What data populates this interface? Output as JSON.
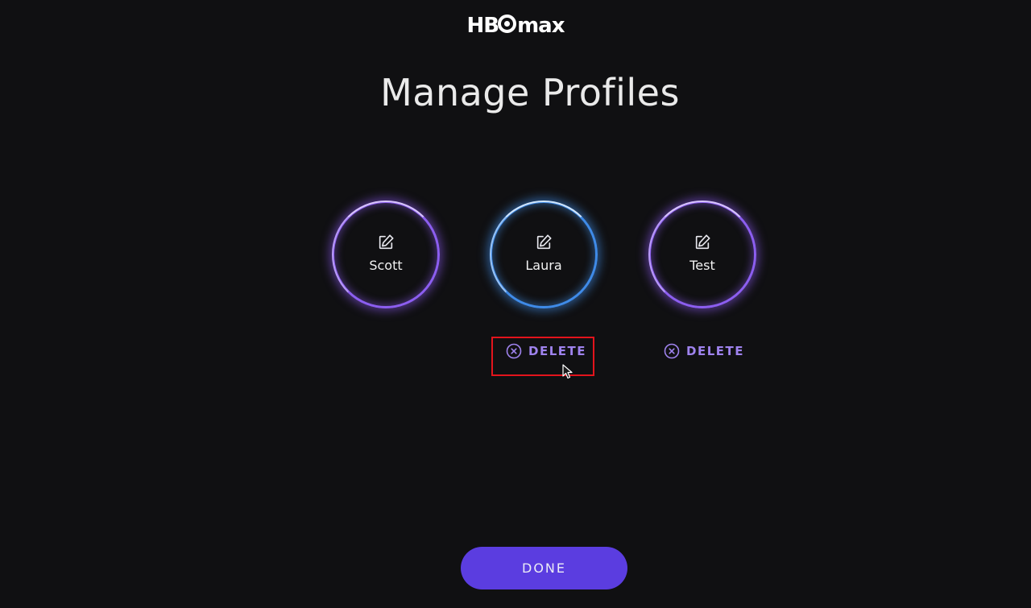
{
  "app": {
    "logo_text_left": "HB",
    "logo_text_right": "max"
  },
  "page": {
    "title": "Manage Profiles"
  },
  "profiles": [
    {
      "name": "Scott",
      "ring_color": "#8c5ef0",
      "edit_icon": "edit-pencil-icon"
    },
    {
      "name": "Laura",
      "ring_color": "#3f8be8",
      "edit_icon": "edit-pencil-icon"
    },
    {
      "name": "Test",
      "ring_color": "#8c5ef0",
      "edit_icon": "edit-pencil-icon"
    }
  ],
  "delete_actions": [
    {
      "label": "DELETE",
      "icon": "close-circle-icon"
    },
    {
      "label": "DELETE",
      "icon": "close-circle-icon"
    }
  ],
  "footer": {
    "done_label": "DONE"
  },
  "colors": {
    "background": "#101012",
    "accent": "#5b3de0",
    "delete_text": "#9f83ee",
    "highlight": "#e3141c"
  }
}
